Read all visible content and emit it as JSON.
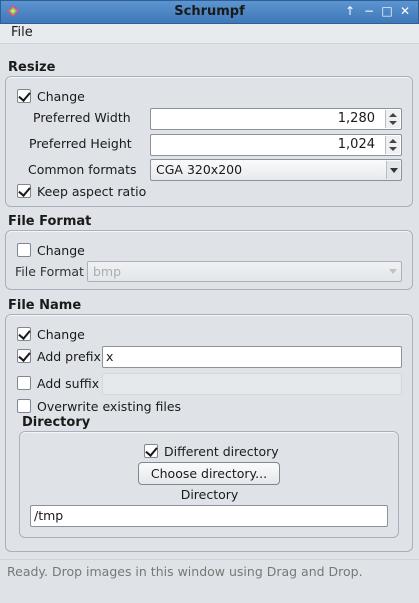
{
  "window": {
    "title": "Schrumpf",
    "title_buttons": [
      "↑",
      "−",
      "□",
      "✕"
    ]
  },
  "menu": {
    "file": "File"
  },
  "resize": {
    "title": "Resize",
    "change_label": "Change",
    "change_checked": true,
    "preferred_width_label": "Preferred Width",
    "preferred_width_value": "1,280",
    "preferred_height_label": "Preferred Height",
    "preferred_height_value": "1,024",
    "common_formats_label": "Common formats",
    "common_formats_value": "CGA 320x200",
    "keep_aspect_label": "Keep aspect ratio",
    "keep_aspect_checked": true
  },
  "file_format": {
    "title": "File Format",
    "change_label": "Change",
    "change_checked": false,
    "format_label": "File Format",
    "format_value": "bmp"
  },
  "file_name": {
    "title": "File Name",
    "change_label": "Change",
    "change_checked": true,
    "add_prefix_label": "Add prefix",
    "add_prefix_checked": true,
    "prefix_value": "x",
    "add_suffix_label": "Add suffix",
    "add_suffix_checked": false,
    "suffix_value": "",
    "overwrite_label": "Overwrite existing files",
    "overwrite_checked": false
  },
  "directory": {
    "title": "Directory",
    "different_label": "Different directory",
    "different_checked": true,
    "choose_button": "Choose directory...",
    "dir_label": "Directory",
    "dir_value": "/tmp"
  },
  "status": {
    "text": "Ready. Drop images in this window using Drag and Drop."
  },
  "colors": {
    "titlebar": "#4a86c5",
    "background": "#dfe3e8"
  }
}
